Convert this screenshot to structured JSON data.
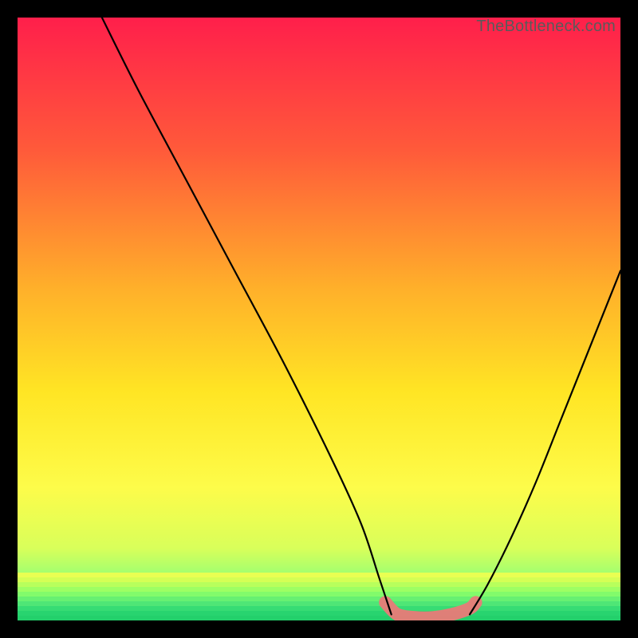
{
  "watermark": "TheBottleneck.com",
  "chart_data": {
    "type": "line",
    "title": "",
    "xlabel": "",
    "ylabel": "",
    "xlim": [
      0,
      100
    ],
    "ylim": [
      0,
      100
    ],
    "grid": false,
    "legend": false,
    "series": [
      {
        "name": "curve-left",
        "x": [
          14,
          20,
          28,
          36,
          44,
          52,
          57,
          60,
          62
        ],
        "y": [
          100,
          88,
          73,
          58,
          43,
          27,
          16,
          7,
          1
        ]
      },
      {
        "name": "curve-right",
        "x": [
          75,
          78,
          82,
          86,
          90,
          94,
          98,
          100
        ],
        "y": [
          1,
          6,
          14,
          23,
          33,
          43,
          53,
          58
        ]
      },
      {
        "name": "highlight-band",
        "x": [
          61,
          63,
          66,
          69,
          72,
          75,
          76
        ],
        "y": [
          3,
          1,
          0.5,
          0.5,
          1,
          2,
          3
        ]
      }
    ],
    "gradient_stops": [
      {
        "offset": 0.0,
        "color": "#ff1f4b"
      },
      {
        "offset": 0.22,
        "color": "#ff5a3a"
      },
      {
        "offset": 0.45,
        "color": "#ffb02a"
      },
      {
        "offset": 0.62,
        "color": "#ffe524"
      },
      {
        "offset": 0.78,
        "color": "#fdfc4a"
      },
      {
        "offset": 0.88,
        "color": "#d9ff5a"
      },
      {
        "offset": 0.94,
        "color": "#8cff78"
      },
      {
        "offset": 1.0,
        "color": "#23e06b"
      }
    ],
    "bottom_stripes": [
      "#e9ff52",
      "#d4ff55",
      "#b8ff5c",
      "#9dff63",
      "#82fb6b",
      "#67f072",
      "#4fe676",
      "#37dc74",
      "#28d46f",
      "#23d06b"
    ],
    "highlight_color": "#e97a78",
    "annotations": []
  }
}
